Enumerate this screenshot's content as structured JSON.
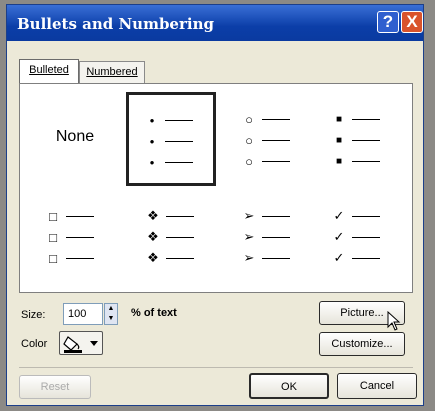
{
  "window": {
    "title": "Bullets and Numbering",
    "help_glyph": "?",
    "close_glyph": "X"
  },
  "tabs": [
    {
      "label": "Bulleted",
      "selected": true
    },
    {
      "label": "Numbered",
      "selected": false
    }
  ],
  "gallery": {
    "none_label": "None",
    "styles": [
      {
        "icon": "filled-dot-bullet-icon",
        "glyph": "•"
      },
      {
        "icon": "hollow-circle-bullet-icon",
        "glyph": "○"
      },
      {
        "icon": "filled-square-bullet-icon",
        "glyph": "■"
      },
      {
        "icon": "hollow-square-bullet-icon",
        "glyph": "□"
      },
      {
        "icon": "four-diamond-bullet-icon",
        "glyph": "❖"
      },
      {
        "icon": "arrowhead-bullet-icon",
        "glyph": "➢"
      },
      {
        "icon": "checkmark-bullet-icon",
        "glyph": "✓"
      }
    ],
    "selected_index": 0
  },
  "size": {
    "label": "Size:",
    "value": "100",
    "unit": "% of text"
  },
  "color": {
    "label": "Color"
  },
  "buttons": {
    "picture": "Picture...",
    "customize": "Customize...",
    "reset": "Reset",
    "ok": "OK",
    "cancel": "Cancel"
  },
  "colors": {
    "titlebar": "#0b3ea8",
    "dialog": "#ece9d8",
    "close": "#d9532c"
  }
}
